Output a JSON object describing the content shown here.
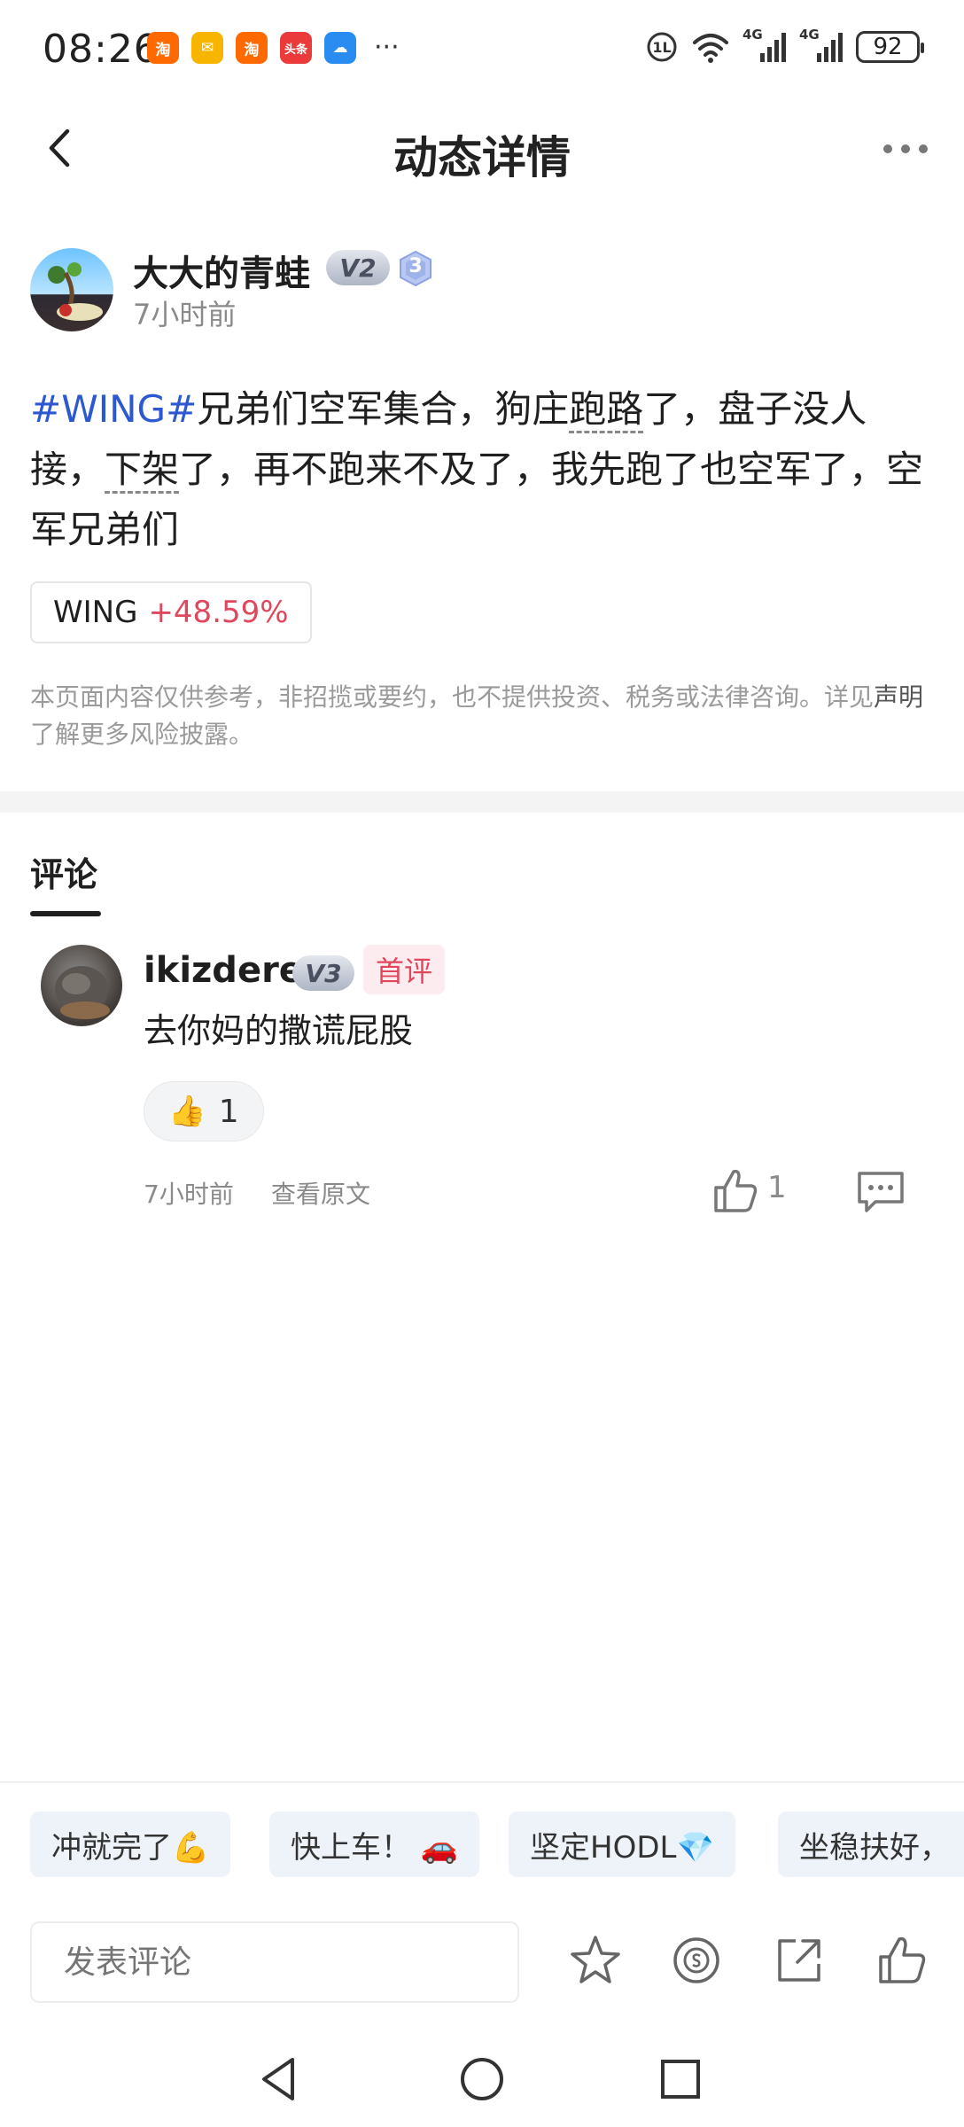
{
  "status_bar": {
    "time": "08:26",
    "app_icons": [
      {
        "name": "taobao",
        "label": "淘",
        "color": "#ff6a00"
      },
      {
        "name": "mail",
        "label": "✉",
        "color": "#f7b500"
      },
      {
        "name": "taobao",
        "label": "淘",
        "color": "#ff6a00"
      },
      {
        "name": "toutiao",
        "label": "头条",
        "color": "#ea3a3a"
      },
      {
        "name": "weather",
        "label": "☁",
        "color": "#2a8cf0"
      }
    ],
    "more_glyph": "···",
    "signal_label_1": "4G",
    "signal_label_2": "4G",
    "battery": "92"
  },
  "header": {
    "title": "动态详情"
  },
  "post": {
    "author": "大大的青蛙",
    "vip_badge": "V2",
    "level_badge": "3",
    "time": "7小时前",
    "hashtag": "#WING#",
    "text_part1": "兄弟们空军集合，狗庄",
    "text_dashed1": "跑路",
    "text_part2": "了，盘子没人接，",
    "text_dashed2": "下架",
    "text_part3": "了，再不跑来不及了，我先跑了也空军了，空军兄弟们",
    "ticker_symbol": "WING",
    "ticker_change": "+48.59%",
    "disclaimer": "本页面内容仅供参考，非招揽或要约，也不提供投资、税务或法律咨询。详见",
    "disclaimer_link": "声明",
    "disclaimer_tail": "了解更多风险披露。"
  },
  "comments_section": {
    "tab_label": "评论",
    "items": [
      {
        "user": "ikizdere",
        "vip_badge": "V3",
        "tag": "首评",
        "text": "去你妈的撒谎屁股",
        "reaction_emoji": "👍",
        "reaction_count": "1",
        "time": "7小时前",
        "view_original": "查看原文",
        "like_count": "1"
      }
    ]
  },
  "quick_replies": [
    "冲就完了💪",
    "快上车！ 🚗",
    "坚定HODL💎",
    "坐稳扶好，"
  ],
  "footer": {
    "input_placeholder": "发表评论"
  }
}
